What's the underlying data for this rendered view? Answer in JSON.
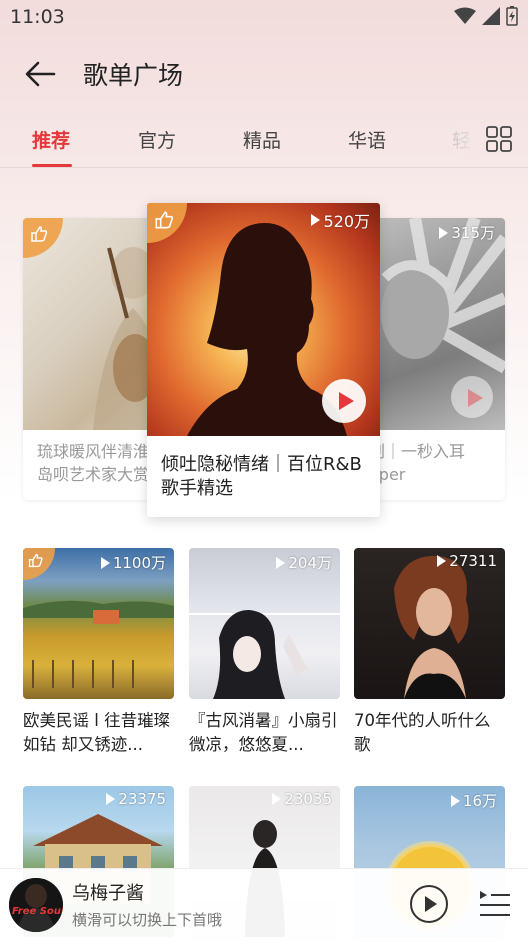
{
  "status_bar": {
    "time": "11:03"
  },
  "header": {
    "title": "歌单广场"
  },
  "tabs": [
    {
      "label": "推荐",
      "active": true
    },
    {
      "label": "官方",
      "active": false
    },
    {
      "label": "精品",
      "active": false
    },
    {
      "label": "华语",
      "active": false
    },
    {
      "label": "轻",
      "active": false
    }
  ],
  "carousel": {
    "left": {
      "title_line1": "琉球暖风伴清淮",
      "title_line2": "岛呗艺术家大赏"
    },
    "center": {
      "play_count": "520万",
      "title": "倾吐隐秘情绪｜百位R&B歌手精选"
    },
    "right": {
      "play_count": "315万",
      "title_line1": "刮｜一秒入耳",
      "title_line2": "oper"
    }
  },
  "playlists": [
    {
      "play_count": "1100万",
      "title": "欧美民谣 l 往昔璀璨如钻 却又锈迹..."
    },
    {
      "play_count": "204万",
      "title": "『古风消暑』小扇引微凉，悠悠夏..."
    },
    {
      "play_count": "27311",
      "title": "70年代的人听什么歌"
    },
    {
      "play_count": "23375",
      "title": ""
    },
    {
      "play_count": "23035",
      "title": ""
    },
    {
      "play_count": "16万",
      "title": ""
    }
  ],
  "player": {
    "song": "乌梅子酱",
    "hint": "横滑可以切换上下首哦",
    "avatar_text": "Free Soul"
  },
  "colors": {
    "accent": "#e6383c"
  }
}
